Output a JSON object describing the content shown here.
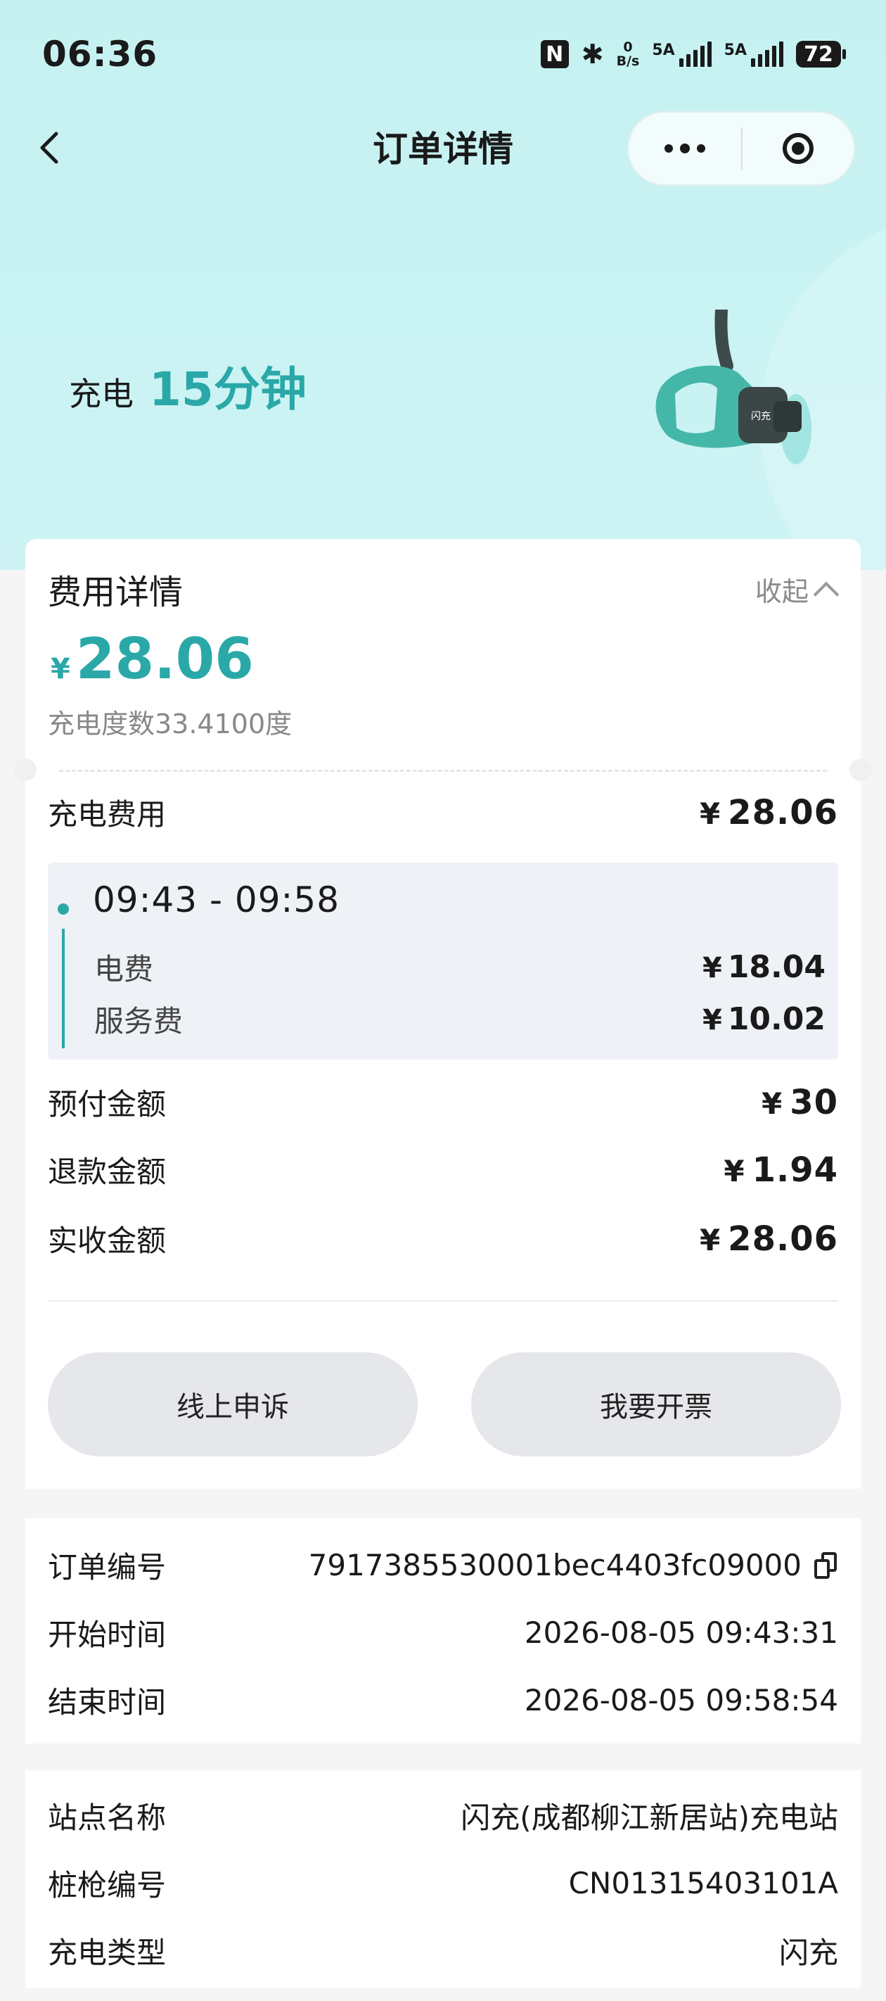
{
  "status_bar": {
    "time": "06:36",
    "nfc": "N",
    "speed_top": "0",
    "speed_bottom": "B/s",
    "sig1_label": "5A",
    "sig2_label": "5A",
    "battery": "72"
  },
  "nav": {
    "title": "订单详情",
    "back_icon": "chevron-left-icon",
    "more_icon": "more-dots-icon",
    "close_icon": "target-close-icon"
  },
  "hero": {
    "label": "充电",
    "duration": "15分钟"
  },
  "fee": {
    "title": "费用详情",
    "collapse_label": "收起",
    "currency": "¥",
    "total": "28.06",
    "kwh_text": "充电度数33.4100度",
    "charge_fee_label": "充电费用",
    "charge_fee_value": "28.06",
    "period": {
      "time": "09:43 - 09:58",
      "electricity_label": "电费",
      "electricity_value": "18.04",
      "service_label": "服务费",
      "service_value": "10.02"
    },
    "prepaid_label": "预付金额",
    "prepaid_value": "30",
    "refund_label": "退款金额",
    "refund_value": "1.94",
    "received_label": "实收金额",
    "received_value": "28.06",
    "appeal_button": "线上申诉",
    "invoice_button": "我要开票"
  },
  "order": {
    "id_label": "订单编号",
    "id_value": "7917385530001bec4403fc09000",
    "start_label": "开始时间",
    "start_value": "2026-08-05 09:43:31",
    "end_label": "结束时间",
    "end_value": "2026-08-05 09:58:54"
  },
  "station": {
    "name_label": "站点名称",
    "name_value": "闪充(成都柳江新居站)充电站",
    "gun_label": "桩枪编号",
    "gun_value": "CN01315403101A",
    "type_label": "充电类型",
    "type_value": "闪充"
  },
  "colors": {
    "accent": "#2aa8a8",
    "hero_bg": "#c6f1f1"
  }
}
